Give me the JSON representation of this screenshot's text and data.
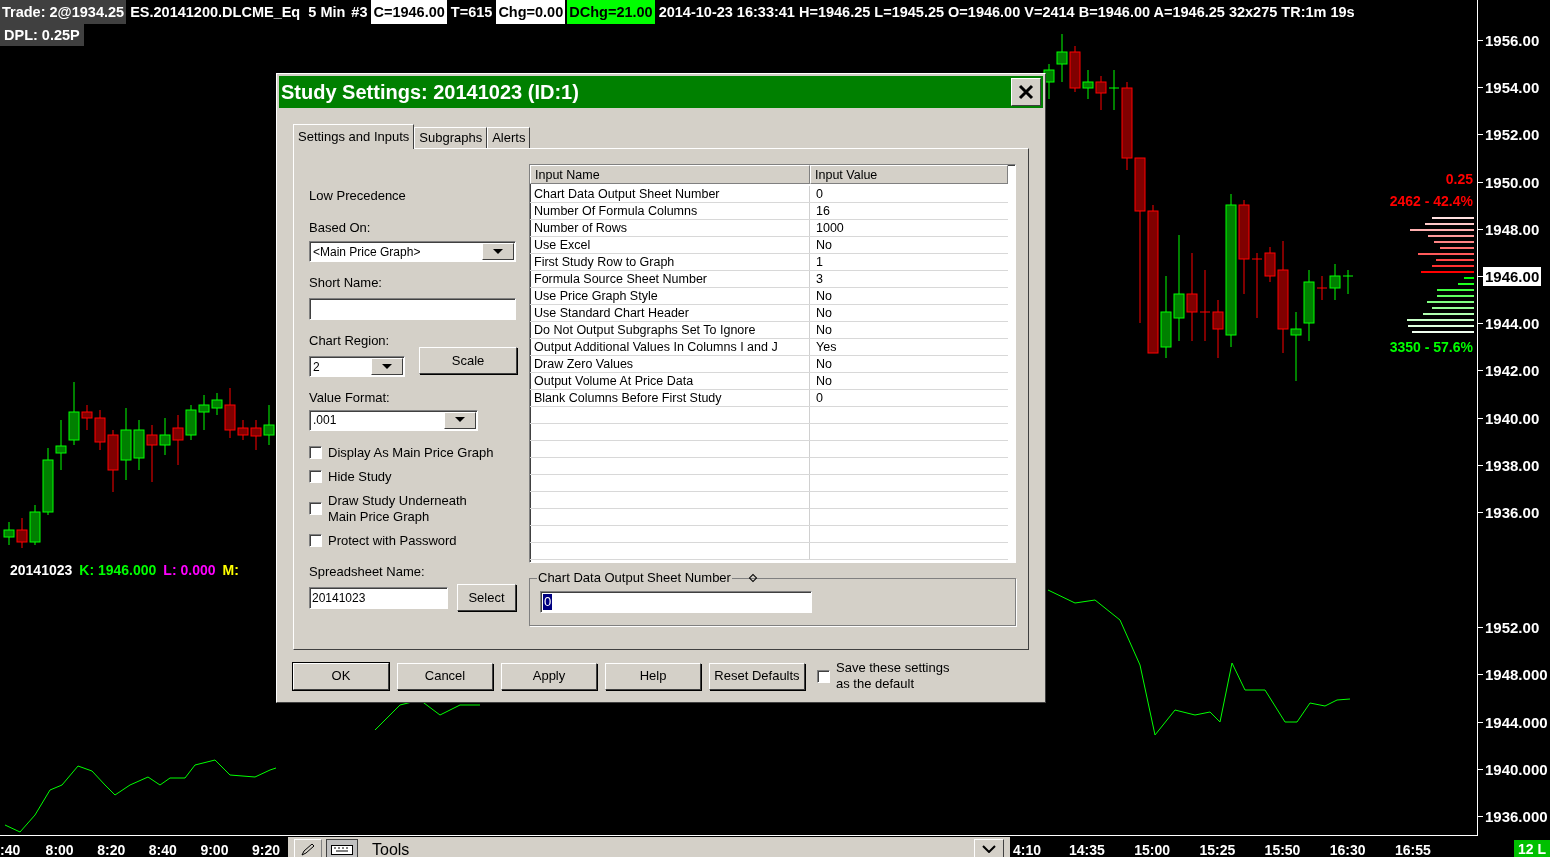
{
  "header": {
    "segments": [
      {
        "text": "Trade: 2@1934.25",
        "kind": "label"
      },
      {
        "text": "ES.20141200.DLCME_Eq  5 Min",
        "kind": "plain"
      },
      {
        "text": "#3",
        "kind": "plain"
      },
      {
        "text": "C=1946.00",
        "kind": "inverse"
      },
      {
        "text": "T=615",
        "kind": "plain"
      },
      {
        "text": "Chg=0.00",
        "kind": "inverse"
      },
      {
        "text": "DChg=21.00",
        "kind": "highlight"
      },
      {
        "text": "2014-10-23 16:33:41 H=1946.25 L=1945.25 O=1946.00 V=2414 B=1946.00 A=1946.25 32x275 TR:1m 19s",
        "kind": "plain"
      }
    ],
    "dpl": "DPL: 0.25P"
  },
  "price_axis": {
    "labels": [
      {
        "text": "1956.00",
        "current": false
      },
      {
        "text": "1954.00",
        "current": false
      },
      {
        "text": "1952.00",
        "current": false
      },
      {
        "text": "1950.00",
        "current": false
      },
      {
        "text": "1948.00",
        "current": false
      },
      {
        "text": "1946.00",
        "current": true
      },
      {
        "text": "1944.00",
        "current": false
      },
      {
        "text": "1942.00",
        "current": false
      },
      {
        "text": "1940.00",
        "current": false
      },
      {
        "text": "1938.00",
        "current": false
      },
      {
        "text": "1936.00",
        "current": false
      }
    ]
  },
  "lower_axis": {
    "labels": [
      "1952.00",
      "1948.000",
      "1944.000",
      "1940.000",
      "1936.000"
    ]
  },
  "time_axis": {
    "left_labels": [
      ":40",
      "8:00",
      "8:20",
      "8:40",
      "9:00",
      "9:20"
    ],
    "right_labels": [
      "4:10",
      "14:35",
      "15:00",
      "15:25",
      "15:50",
      "16:30",
      "16:55"
    ]
  },
  "study_legend": [
    {
      "text": "20141023",
      "color": "#ffffff"
    },
    {
      "text": "K: 1946.000",
      "color": "#00ff00"
    },
    {
      "text": "L: 0.000",
      "color": "#ff00ff"
    },
    {
      "text": "M:",
      "color": "#ffff00"
    }
  ],
  "volume_profile": {
    "tick_size": "0.25",
    "ask_summary": "2462 - 42.4%",
    "bid_summary": "3350 - 57.6%"
  },
  "toolbar": {
    "title": "Tools"
  },
  "status_badge": "12 L",
  "dialog": {
    "title": "Study Settings: 20141023 (ID:1)",
    "tabs": [
      {
        "label": "Settings and Inputs",
        "selected": true
      },
      {
        "label": "Subgraphs",
        "selected": false
      },
      {
        "label": "Alerts",
        "selected": false
      }
    ],
    "precedence": "Low Precedence",
    "based_on": {
      "label": "Based On:",
      "value": "<Main Price Graph>"
    },
    "short_name": {
      "label": "Short Name:"
    },
    "chart_region": {
      "label": "Chart Region:",
      "value": "2"
    },
    "scale_button": "Scale",
    "value_format": {
      "label": "Value Format:",
      "value": ".001"
    },
    "checkboxes": [
      {
        "label": "Display As Main Price Graph",
        "checked": false
      },
      {
        "label": "Hide Study",
        "checked": false
      },
      {
        "label": "Draw Study Underneath Main Price Graph",
        "checked": false
      },
      {
        "label": "Protect with Password",
        "checked": false
      }
    ],
    "spreadsheet_name": {
      "label": "Spreadsheet Name:",
      "value": "20141023"
    },
    "select_button": "Select",
    "table": {
      "columns": [
        "Input Name",
        "Input Value"
      ],
      "rows": [
        {
          "name": "Chart Data Output Sheet Number",
          "value": "0"
        },
        {
          "name": "Number Of Formula Columns",
          "value": "16"
        },
        {
          "name": "Number of Rows",
          "value": "1000"
        },
        {
          "name": "Use Excel",
          "value": "No"
        },
        {
          "name": "First Study Row to Graph",
          "value": "1"
        },
        {
          "name": "Formula Source Sheet Number",
          "value": "3"
        },
        {
          "name": "Use Price Graph Style",
          "value": "No"
        },
        {
          "name": "Use Standard Chart Header",
          "value": "No"
        },
        {
          "name": "Do Not Output Subgraphs Set To Ignore",
          "value": "No"
        },
        {
          "name": "Output Additional Values In Columns I and J",
          "value": "Yes"
        },
        {
          "name": "Draw Zero Values",
          "value": "No"
        },
        {
          "name": "Output Volume At Price Data",
          "value": "No"
        },
        {
          "name": "Blank Columns Before First Study",
          "value": "0"
        }
      ]
    },
    "detail": {
      "label": "Chart Data Output Sheet Number",
      "value": "0"
    },
    "buttons": [
      "OK",
      "Cancel",
      "Apply",
      "Help",
      "Reset Defaults"
    ],
    "save_default": {
      "label": "Save these settings as the default",
      "checked": false
    }
  }
}
